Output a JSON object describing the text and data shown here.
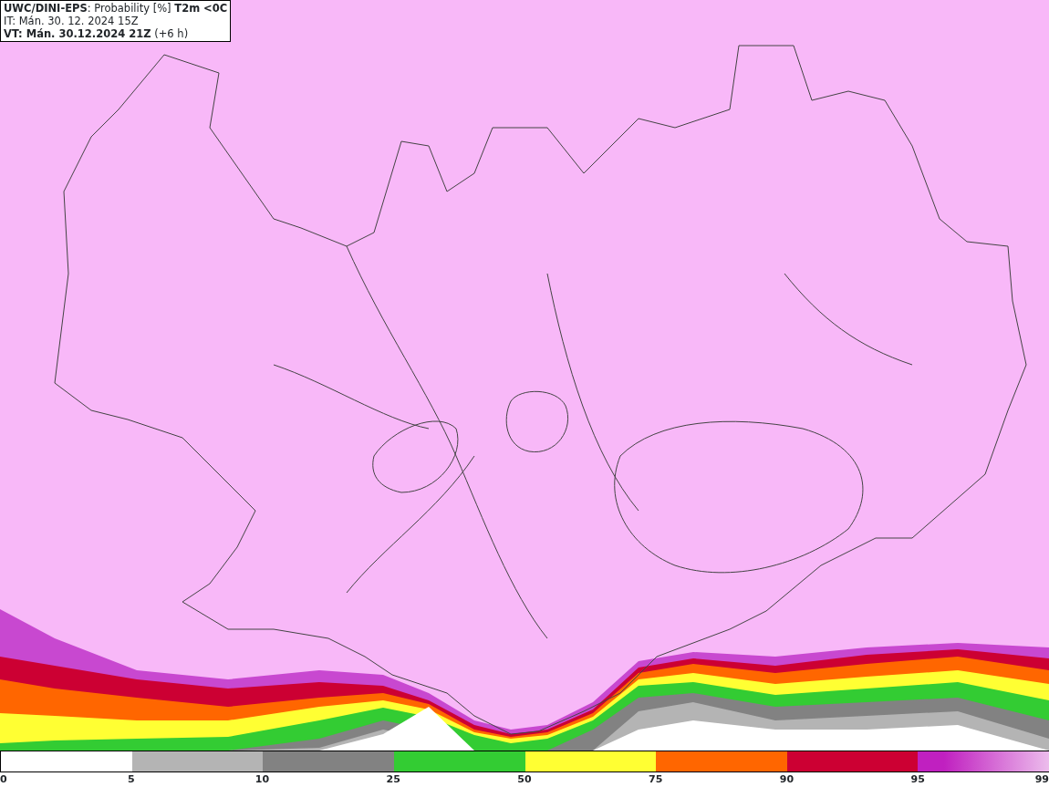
{
  "header": {
    "lines": [
      "**UWC/DINI-EPS**: Probability [%] **T2m <0C**",
      "IT: Mán. 30. 12. 2024 15Z",
      "**VT: Mán. 30.12.2024 21Z** (+6 h)"
    ]
  },
  "legend": {
    "segments": [
      {
        "color": "#ffffff"
      },
      {
        "color": "#b4b4b4"
      },
      {
        "color": "#828282"
      },
      {
        "color": "#33cc33"
      },
      {
        "color": "#ffff33"
      },
      {
        "color": "#ff6600"
      },
      {
        "color": "#cc0033"
      },
      {
        "color": "#c020c0",
        "kind": "gradient"
      }
    ],
    "ticks": [
      "0",
      "5",
      "10",
      "25",
      "50",
      "75",
      "90",
      "95",
      "99"
    ]
  }
}
